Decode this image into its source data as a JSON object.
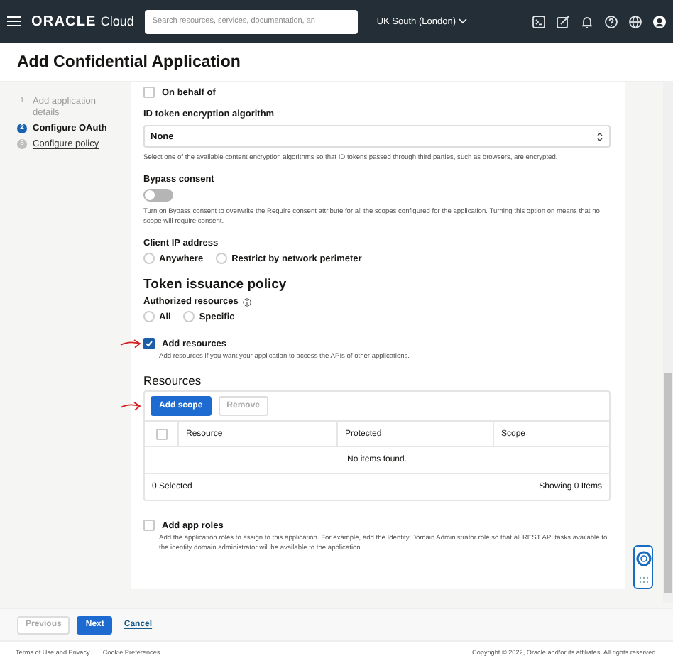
{
  "header": {
    "brand": "ORACLE",
    "product": "Cloud",
    "search": {
      "placeholder": "Search resources, services, documentation, an"
    },
    "region": "UK South (London)"
  },
  "page_title": "Add Confidential Application",
  "steps": [
    {
      "number": "1",
      "label": "Add application details",
      "completed": true,
      "selected": false
    },
    {
      "number": "2",
      "label": "Configure OAuth",
      "completed": false,
      "selected": true
    },
    {
      "number": "3",
      "label": "Configure policy",
      "completed": false,
      "selected": false
    }
  ],
  "form": {
    "on_behalf_of": {
      "label": "On behalf of",
      "checked": false
    },
    "id_token_encryption": {
      "label": "ID token encryption algorithm",
      "value": "None",
      "help": "Select one of the available content encryption algorithms so that ID tokens passed through third parties, such as browsers, are encrypted."
    },
    "bypass_consent": {
      "label": "Bypass consent",
      "on": false,
      "help": "Turn on Bypass consent to overwrite the Require consent attribute for all the scopes configured for the application. Turning this option on means that no scope will require consent."
    },
    "client_ip": {
      "label": "Client IP address",
      "options": [
        {
          "label": "Anywhere",
          "selected": false
        },
        {
          "label": "Restrict by network perimeter",
          "selected": false
        }
      ]
    },
    "token_issuance": {
      "heading": "Token issuance policy",
      "label": "Authorized resources",
      "options": [
        {
          "label": "All",
          "selected": false
        },
        {
          "label": "Specific",
          "selected": false
        }
      ]
    },
    "add_resources": {
      "label": "Add resources",
      "checked": true,
      "help": "Add resources if you want your application to access the APIs of other applications."
    },
    "resources": {
      "heading": "Resources",
      "buttons": [
        {
          "label": "Add scope",
          "disabled": false
        },
        {
          "label": "Remove",
          "disabled": true
        }
      ],
      "table": {
        "select_all_checked": false,
        "columns": [
          "Resource",
          "Protected",
          "Scope"
        ],
        "empty_text": "No items found.",
        "selected_count": "0 Selected",
        "showing": "Showing 0 Items"
      }
    },
    "add_app_roles": {
      "label": "Add app roles",
      "checked": false,
      "help": "Add the application roles to assign to this application. For example, add the Identity Domain Administrator role so that all REST API tasks available to the identity domain administrator will be available to the application."
    }
  },
  "actions": [
    {
      "kind": "secondary",
      "label": "Previous",
      "disabled": true
    },
    {
      "kind": "primary",
      "label": "Next",
      "disabled": false
    },
    {
      "kind": "link",
      "label": "Cancel",
      "disabled": false
    }
  ],
  "footer": {
    "links": [
      "Terms of Use and Privacy",
      "Cookie Preferences"
    ],
    "copyright": "Copyright © 2022, Oracle and/or its affiliates. All rights reserved."
  }
}
